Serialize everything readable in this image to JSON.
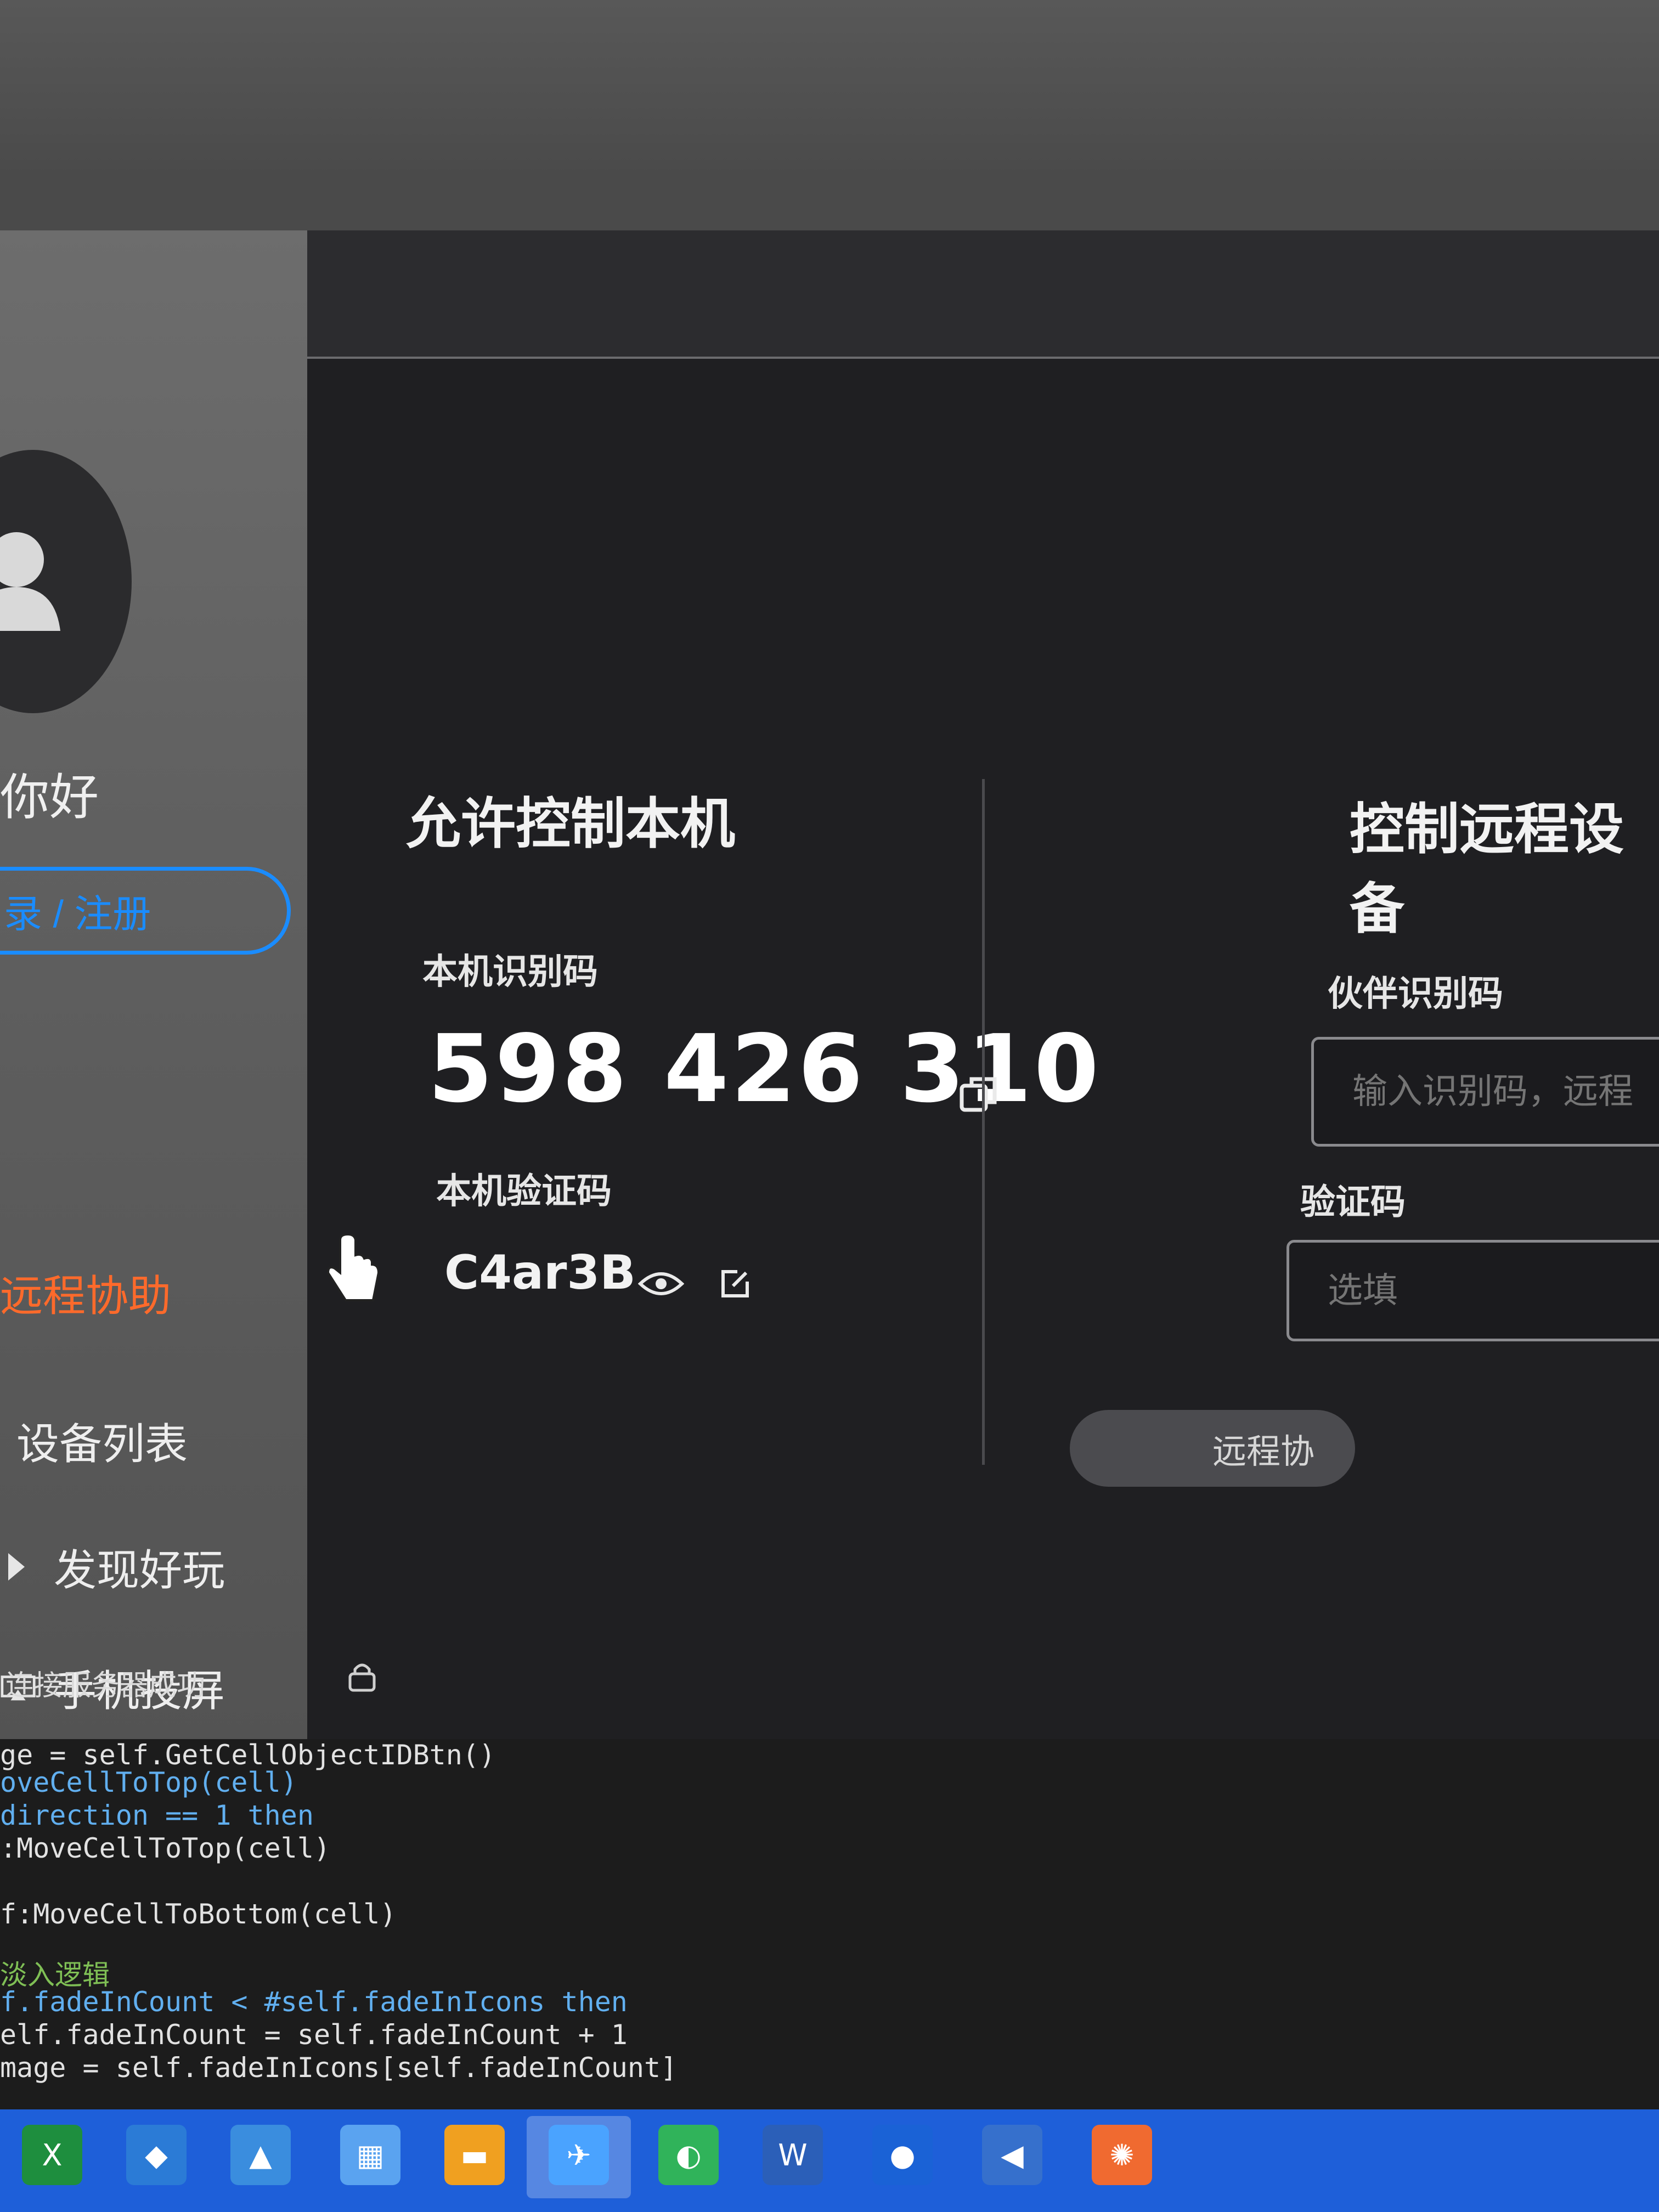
{
  "sidebar": {
    "greeting": "你好",
    "login_button": "录 / 注册",
    "nav": [
      {
        "label": "远程协助",
        "icon": "remote-assist-icon",
        "active": true
      },
      {
        "label": "设备列表",
        "icon": "device-list-icon",
        "active": false
      },
      {
        "label": "发现好玩",
        "icon": "discover-icon",
        "active": false
      },
      {
        "label": "手机投屏",
        "icon": "screen-cast-icon",
        "active": false
      }
    ],
    "status": "连接服务器成功"
  },
  "allow_control": {
    "title": "允许控制本机",
    "device_id_label": "本机识别码",
    "device_id": "598 426 310",
    "verify_code_label": "本机验证码",
    "verify_code": "C4ar3B"
  },
  "remote_control": {
    "title": "控制远程设备",
    "partner_id_label": "伙伴识别码",
    "partner_id_placeholder": "输入识别码，远程",
    "verify_code_label": "验证码",
    "verify_code_placeholder": "选填",
    "connect_button": "远程协"
  },
  "code_lines": [
    "ge = self.GetCellObjectIDBtn()",
    "oveCellToTop(cell)",
    "direction == 1 then",
    ":MoveCellToTop(cell)",
    "f:MoveCellToBottom(cell)",
    "淡入逻辑",
    "f.fadeInCount < #self.fadeInIcons then",
    "elf.fadeInCount = self.fadeInCount + 1",
    "mage = self.fadeInIcons[self.fadeInCount]"
  ],
  "colors": {
    "accent_blue": "#1a8cff",
    "active_orange": "#ff6a2b",
    "taskbar_blue": "#1e5fd9"
  }
}
